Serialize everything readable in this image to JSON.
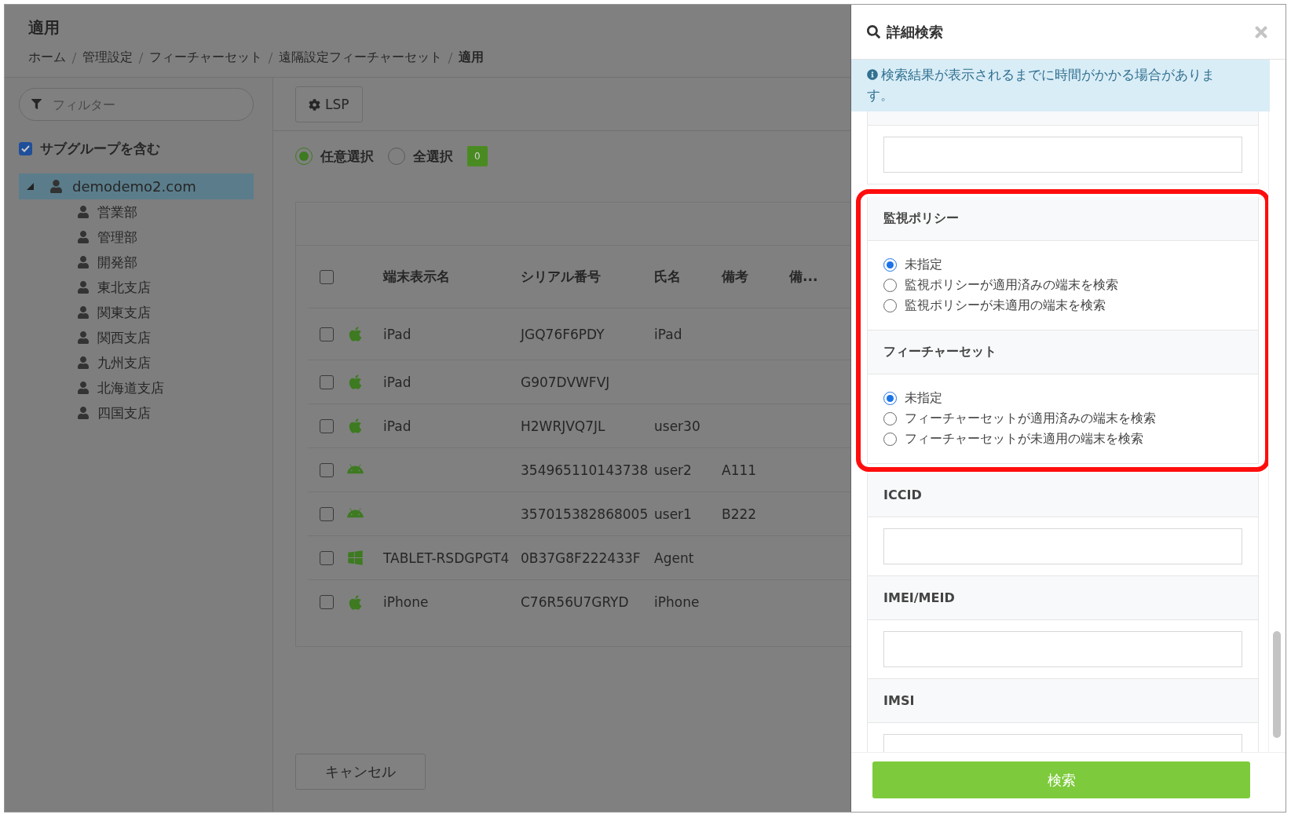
{
  "page": {
    "title": "適用",
    "breadcrumbs": [
      {
        "label": "ホーム",
        "current": false
      },
      {
        "label": "管理設定",
        "current": false
      },
      {
        "label": "フィーチャーセット",
        "current": false
      },
      {
        "label": "遠隔設定フィーチャーセット",
        "current": false
      },
      {
        "label": "適用",
        "current": true
      }
    ]
  },
  "sidebar": {
    "filter": {
      "placeholder": "フィルター"
    },
    "include_subgroups": {
      "label": "サブグループを含む",
      "checked": true
    },
    "tree": [
      {
        "label": "demodemo2.com",
        "expanded": true,
        "selected": true,
        "children": [
          {
            "label": "営業部",
            "selected": false
          },
          {
            "label": "管理部",
            "selected": false
          },
          {
            "label": "開発部",
            "selected": false
          },
          {
            "label": "東北支店",
            "selected": false
          },
          {
            "label": "関東支店",
            "selected": false
          },
          {
            "label": "関西支店",
            "selected": false
          },
          {
            "label": "九州支店",
            "selected": false
          },
          {
            "label": "北海道支店",
            "selected": false
          },
          {
            "label": "四国支店",
            "selected": false
          }
        ]
      }
    ]
  },
  "toolbar": {
    "buttons": [
      {
        "label": "LSP"
      }
    ]
  },
  "selection": {
    "options": [
      {
        "label": "任意選択",
        "selected": true
      },
      {
        "label": "全選択",
        "selected": false
      }
    ],
    "count": "0"
  },
  "table": {
    "header_checked": false,
    "columns": [
      "端末表示名",
      "シリアル番号",
      "氏名",
      "備考",
      "備..."
    ],
    "rows": [
      {
        "checked": false,
        "kind": "apple",
        "name": "iPad",
        "serial": "JGQ76F6PDY",
        "user": "iPad"
      },
      {
        "checked": false,
        "kind": "apple",
        "name": "iPad",
        "serial": "G907DVWFVJ"
      },
      {
        "checked": false,
        "kind": "apple",
        "name": "iPad",
        "serial": "H2WRJVQ7JL",
        "user": "user30"
      },
      {
        "checked": false,
        "kind": "android",
        "serial": "354965110143738",
        "user": "user2",
        "note": "A111"
      },
      {
        "checked": false,
        "kind": "android",
        "serial": "357015382868005",
        "user": "user1",
        "note": "B222"
      },
      {
        "checked": false,
        "kind": "windows",
        "name": "TABLET-RSDGPGT4",
        "serial": "0B37G8F222433F",
        "user": "Agent"
      },
      {
        "checked": false,
        "kind": "apple",
        "name": "iPhone",
        "serial": "C76R56U7GRYD",
        "user": "iPhone"
      }
    ]
  },
  "cancel_button": "キャンセル",
  "drawer": {
    "title": "詳細検索",
    "notice": "検索結果が表示されるまでに時間がかかる場合があります。",
    "sections": [
      {
        "kind": "input"
      },
      {
        "kind": "highlight",
        "sections": [
          {
            "kind": "radio",
            "label": "監視ポリシー",
            "options": [
              {
                "label": "未指定",
                "selected": true
              },
              {
                "label": "監視ポリシーが適用済みの端末を検索",
                "selected": false
              },
              {
                "label": "監視ポリシーが未適用の端末を検索",
                "selected": false
              }
            ]
          },
          {
            "kind": "radio",
            "label": "フィーチャーセット",
            "options": [
              {
                "label": "未指定",
                "selected": true
              },
              {
                "label": "フィーチャーセットが適用済みの端末を検索",
                "selected": false
              },
              {
                "label": "フィーチャーセットが未適用の端末を検索",
                "selected": false
              }
            ]
          }
        ]
      },
      {
        "kind": "input",
        "label": "ICCID"
      },
      {
        "kind": "input",
        "label": "IMEI/MEID"
      },
      {
        "kind": "input",
        "label": "IMSI"
      }
    ],
    "submit": "検索"
  }
}
